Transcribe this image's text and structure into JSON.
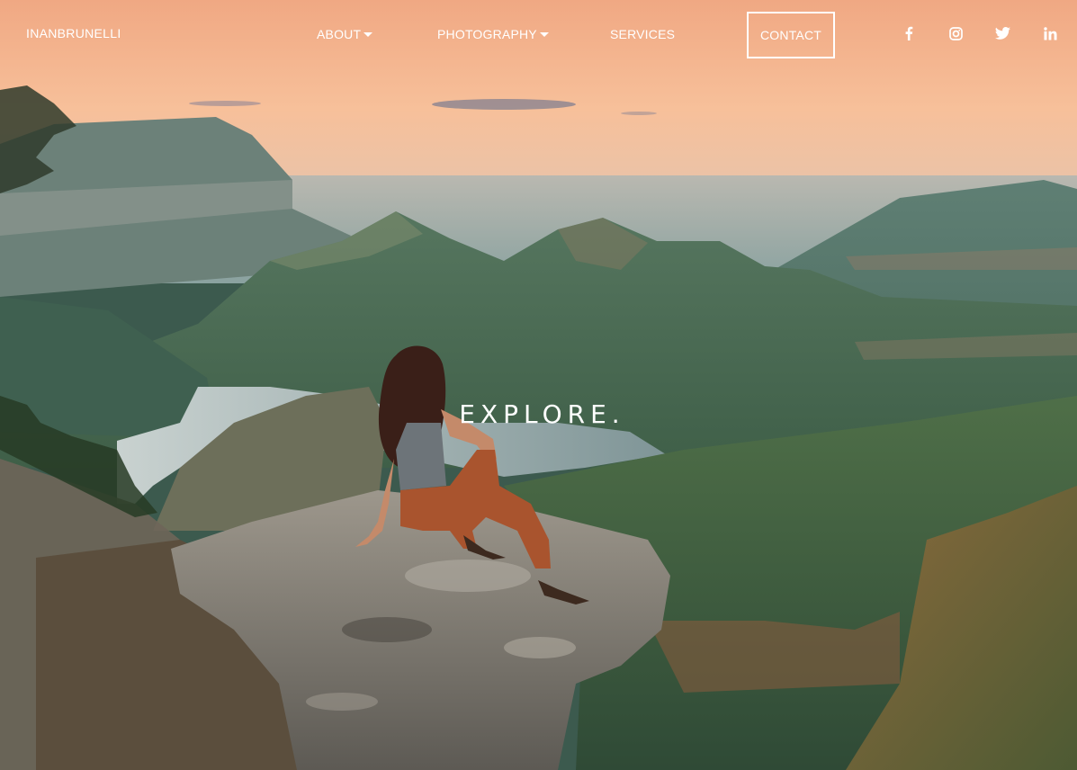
{
  "nav": {
    "brand": "INANBRUNELLI",
    "items": [
      {
        "label": "ABOUT",
        "has_dropdown": true
      },
      {
        "label": "PHOTOGRAPHY",
        "has_dropdown": true
      },
      {
        "label": "SERVICES",
        "has_dropdown": false
      }
    ],
    "contact_label": "CONTACT",
    "social": [
      {
        "icon": "facebook-icon"
      },
      {
        "icon": "instagram-icon"
      },
      {
        "icon": "twitter-icon"
      },
      {
        "icon": "linkedin-icon"
      }
    ]
  },
  "hero": {
    "title": "EXPLORE.",
    "image": "woman sitting on cliff edge overlooking mountains and river at sunset"
  },
  "colors": {
    "nav_text": "#ffffff",
    "sky_top": "#f3b38c",
    "sky_bottom": "#f6c6a4",
    "mountain_far": "#6f8e88",
    "mountain_near": "#4c6f5a",
    "rock": "#8f8a80",
    "pants": "#a8542e"
  }
}
